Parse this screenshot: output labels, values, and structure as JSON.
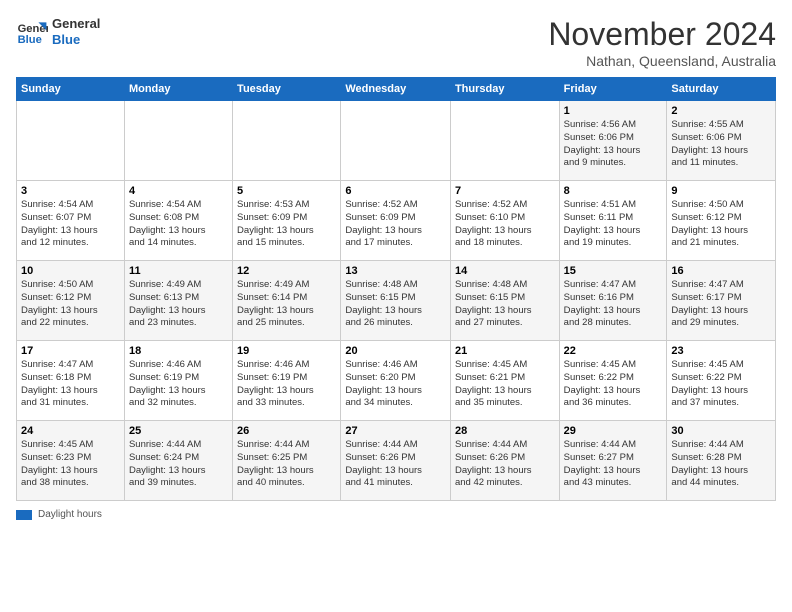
{
  "logo": {
    "line1": "General",
    "line2": "Blue"
  },
  "title": "November 2024",
  "location": "Nathan, Queensland, Australia",
  "days_header": [
    "Sunday",
    "Monday",
    "Tuesday",
    "Wednesday",
    "Thursday",
    "Friday",
    "Saturday"
  ],
  "weeks": [
    [
      {
        "num": "",
        "info": ""
      },
      {
        "num": "",
        "info": ""
      },
      {
        "num": "",
        "info": ""
      },
      {
        "num": "",
        "info": ""
      },
      {
        "num": "",
        "info": ""
      },
      {
        "num": "1",
        "info": "Sunrise: 4:56 AM\nSunset: 6:06 PM\nDaylight: 13 hours\nand 9 minutes."
      },
      {
        "num": "2",
        "info": "Sunrise: 4:55 AM\nSunset: 6:06 PM\nDaylight: 13 hours\nand 11 minutes."
      }
    ],
    [
      {
        "num": "3",
        "info": "Sunrise: 4:54 AM\nSunset: 6:07 PM\nDaylight: 13 hours\nand 12 minutes."
      },
      {
        "num": "4",
        "info": "Sunrise: 4:54 AM\nSunset: 6:08 PM\nDaylight: 13 hours\nand 14 minutes."
      },
      {
        "num": "5",
        "info": "Sunrise: 4:53 AM\nSunset: 6:09 PM\nDaylight: 13 hours\nand 15 minutes."
      },
      {
        "num": "6",
        "info": "Sunrise: 4:52 AM\nSunset: 6:09 PM\nDaylight: 13 hours\nand 17 minutes."
      },
      {
        "num": "7",
        "info": "Sunrise: 4:52 AM\nSunset: 6:10 PM\nDaylight: 13 hours\nand 18 minutes."
      },
      {
        "num": "8",
        "info": "Sunrise: 4:51 AM\nSunset: 6:11 PM\nDaylight: 13 hours\nand 19 minutes."
      },
      {
        "num": "9",
        "info": "Sunrise: 4:50 AM\nSunset: 6:12 PM\nDaylight: 13 hours\nand 21 minutes."
      }
    ],
    [
      {
        "num": "10",
        "info": "Sunrise: 4:50 AM\nSunset: 6:12 PM\nDaylight: 13 hours\nand 22 minutes."
      },
      {
        "num": "11",
        "info": "Sunrise: 4:49 AM\nSunset: 6:13 PM\nDaylight: 13 hours\nand 23 minutes."
      },
      {
        "num": "12",
        "info": "Sunrise: 4:49 AM\nSunset: 6:14 PM\nDaylight: 13 hours\nand 25 minutes."
      },
      {
        "num": "13",
        "info": "Sunrise: 4:48 AM\nSunset: 6:15 PM\nDaylight: 13 hours\nand 26 minutes."
      },
      {
        "num": "14",
        "info": "Sunrise: 4:48 AM\nSunset: 6:15 PM\nDaylight: 13 hours\nand 27 minutes."
      },
      {
        "num": "15",
        "info": "Sunrise: 4:47 AM\nSunset: 6:16 PM\nDaylight: 13 hours\nand 28 minutes."
      },
      {
        "num": "16",
        "info": "Sunrise: 4:47 AM\nSunset: 6:17 PM\nDaylight: 13 hours\nand 29 minutes."
      }
    ],
    [
      {
        "num": "17",
        "info": "Sunrise: 4:47 AM\nSunset: 6:18 PM\nDaylight: 13 hours\nand 31 minutes."
      },
      {
        "num": "18",
        "info": "Sunrise: 4:46 AM\nSunset: 6:19 PM\nDaylight: 13 hours\nand 32 minutes."
      },
      {
        "num": "19",
        "info": "Sunrise: 4:46 AM\nSunset: 6:19 PM\nDaylight: 13 hours\nand 33 minutes."
      },
      {
        "num": "20",
        "info": "Sunrise: 4:46 AM\nSunset: 6:20 PM\nDaylight: 13 hours\nand 34 minutes."
      },
      {
        "num": "21",
        "info": "Sunrise: 4:45 AM\nSunset: 6:21 PM\nDaylight: 13 hours\nand 35 minutes."
      },
      {
        "num": "22",
        "info": "Sunrise: 4:45 AM\nSunset: 6:22 PM\nDaylight: 13 hours\nand 36 minutes."
      },
      {
        "num": "23",
        "info": "Sunrise: 4:45 AM\nSunset: 6:22 PM\nDaylight: 13 hours\nand 37 minutes."
      }
    ],
    [
      {
        "num": "24",
        "info": "Sunrise: 4:45 AM\nSunset: 6:23 PM\nDaylight: 13 hours\nand 38 minutes."
      },
      {
        "num": "25",
        "info": "Sunrise: 4:44 AM\nSunset: 6:24 PM\nDaylight: 13 hours\nand 39 minutes."
      },
      {
        "num": "26",
        "info": "Sunrise: 4:44 AM\nSunset: 6:25 PM\nDaylight: 13 hours\nand 40 minutes."
      },
      {
        "num": "27",
        "info": "Sunrise: 4:44 AM\nSunset: 6:26 PM\nDaylight: 13 hours\nand 41 minutes."
      },
      {
        "num": "28",
        "info": "Sunrise: 4:44 AM\nSunset: 6:26 PM\nDaylight: 13 hours\nand 42 minutes."
      },
      {
        "num": "29",
        "info": "Sunrise: 4:44 AM\nSunset: 6:27 PM\nDaylight: 13 hours\nand 43 minutes."
      },
      {
        "num": "30",
        "info": "Sunrise: 4:44 AM\nSunset: 6:28 PM\nDaylight: 13 hours\nand 44 minutes."
      }
    ]
  ],
  "legend": {
    "daylight_label": "Daylight hours"
  }
}
